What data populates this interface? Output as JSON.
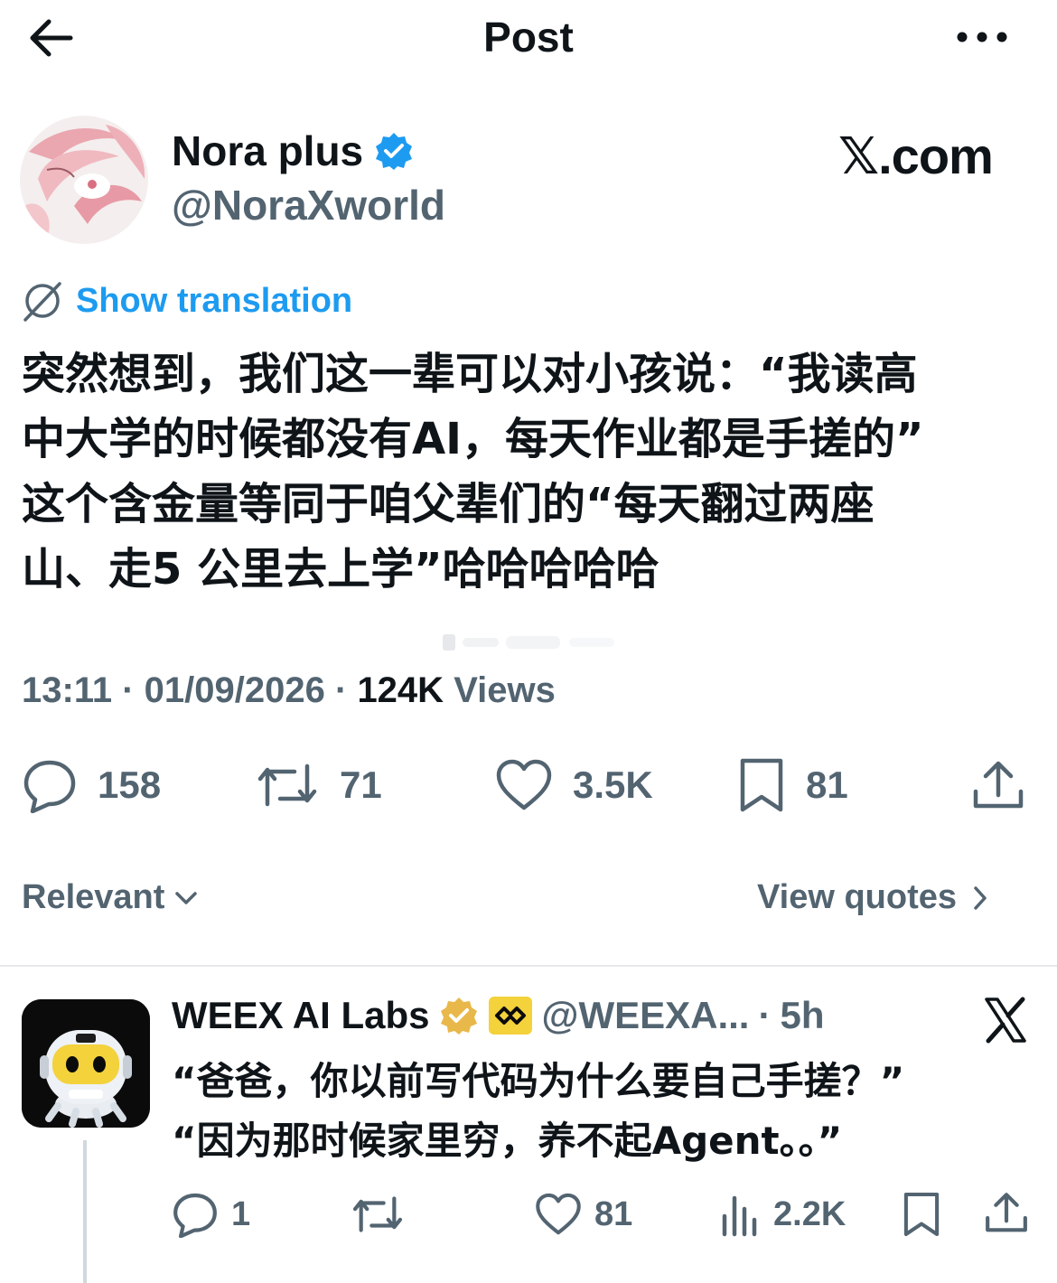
{
  "header": {
    "title": "Post",
    "back_icon": "arrow-left-icon",
    "more_icon": "more-horizontal-icon"
  },
  "author": {
    "name": "Nora plus",
    "handle": "@NoraXworld",
    "verified": true,
    "brand": "𝕏.com"
  },
  "translation": {
    "label": "Show translation"
  },
  "post": {
    "lines": [
      "突然想到，我们这一辈可以对小孩说：“我读高",
      "中大学的时候都没有AI，每天作业都是手搓的”",
      "这个含金量等同于咱父辈们的“每天翻过两座",
      "山、走5 公里去上学”哈哈哈哈哈"
    ]
  },
  "meta": {
    "time": "13:11",
    "date": "01/09/2026",
    "views_count": "124K",
    "views_label": "Views"
  },
  "actions": {
    "replies": "158",
    "reposts": "71",
    "likes": "3.5K",
    "bookmarks": "81"
  },
  "sort": {
    "relevant": "Relevant",
    "view_quotes": "View quotes"
  },
  "reply": {
    "name": "WEEX AI Labs",
    "handle": "@WEEXA...",
    "time": "5h",
    "lines": [
      "“爸爸，你以前写代码为什么要自己手搓？”",
      "“因为那时候家里穷，养不起Agent。。”"
    ],
    "actions": {
      "replies": "1",
      "likes": "81",
      "views": "2.2K"
    }
  },
  "colors": {
    "accent": "#1d9bf0",
    "secondary_text": "#536471",
    "gold_badge": "#e8b84a"
  }
}
